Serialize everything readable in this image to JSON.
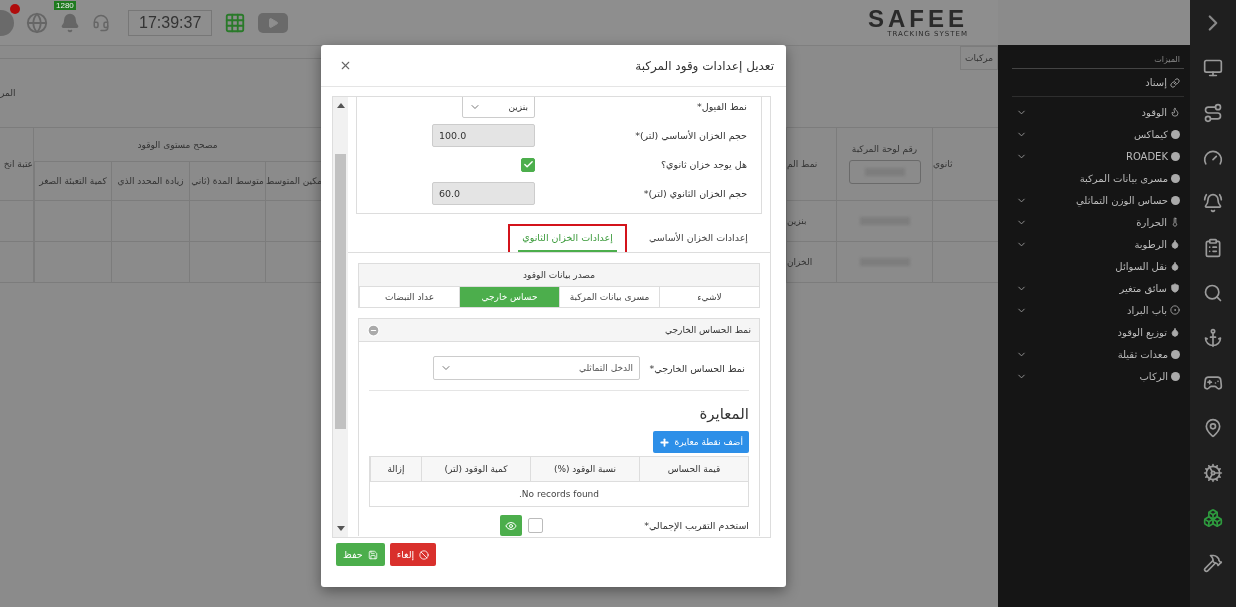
{
  "top_bar": {
    "notification_count": "1280",
    "clock": "17:39:37",
    "logo": {
      "name": "SAFEE",
      "tagline": "TRACKING SYSTEM"
    }
  },
  "background": {
    "tab_label": "مركبات",
    "section_label": "المر",
    "left_table": {
      "group": "مصحح مستوى الوقود",
      "columns": [
        "مكين المتوسط",
        "متوسط المدة (ثاني",
        "زيادة المحدد الذي",
        "كمية التعبئة الصغر"
      ],
      "end_column": "عتبة انخ"
    },
    "right_table": {
      "columns": [
        "ثانوي",
        "رقم لوحة المركبة",
        "نمط الم"
      ],
      "rows": [
        "بنزين",
        "الخزان"
      ]
    }
  },
  "sidebar": {
    "heading": "الميزات",
    "link": "إسناد",
    "items": [
      {
        "label": "الوقود",
        "kind": "flame",
        "expandable": true
      },
      {
        "label": "كيماكس",
        "kind": "dot",
        "expandable": true
      },
      {
        "label": "ROADEK",
        "kind": "dot",
        "expandable": true
      },
      {
        "label": "مسرى بيانات المركبة",
        "kind": "dot",
        "expandable": false
      },
      {
        "label": "حساس الوزن التماثلي",
        "kind": "dot",
        "expandable": true
      },
      {
        "label": "الحرارة",
        "kind": "thermometer",
        "expandable": true
      },
      {
        "label": "الرطوبة",
        "kind": "droplet",
        "expandable": true
      },
      {
        "label": "نقل السوائل",
        "kind": "droplet",
        "expandable": false
      },
      {
        "label": "سائق متغير",
        "kind": "shield",
        "expandable": true
      },
      {
        "label": "باب البراد",
        "kind": "target",
        "expandable": true
      },
      {
        "label": "توزيع الوقود",
        "kind": "droplet",
        "expandable": false
      },
      {
        "label": "معدات ثقيلة",
        "kind": "dot",
        "expandable": true
      },
      {
        "label": "الركاب",
        "kind": "dot",
        "expandable": true
      }
    ]
  },
  "rail": {
    "items": [
      {
        "kind": "monitor",
        "selected": false
      },
      {
        "kind": "route",
        "selected": false
      },
      {
        "kind": "gauge",
        "selected": false
      },
      {
        "kind": "bell",
        "selected": false
      },
      {
        "kind": "clipboard",
        "selected": false
      },
      {
        "kind": "search",
        "selected": false
      },
      {
        "kind": "anchor",
        "selected": false
      },
      {
        "kind": "gamepad",
        "selected": false
      },
      {
        "kind": "pin",
        "selected": false
      },
      {
        "kind": "gears",
        "selected": false
      },
      {
        "kind": "cubes",
        "selected": true
      },
      {
        "kind": "hammer",
        "selected": false
      }
    ]
  },
  "modal": {
    "title": "تعديل إعدادات وقود المركبة",
    "form": [
      {
        "kind": "select",
        "label": "نمط الفيول*",
        "value": "بنزين"
      },
      {
        "kind": "input",
        "label": "حجم الخزان الأساسي (لتر)*",
        "value": "100.0",
        "disabled": true
      },
      {
        "kind": "checkbox",
        "label": "هل يوجد خزان ثانوي؟",
        "checked": true
      },
      {
        "kind": "input",
        "label": "حجم الخزان الثانوي (لتر)*",
        "value": "60.0",
        "disabled": true
      }
    ],
    "tabs": [
      {
        "label": "إعدادات الخزان الأساسي",
        "selected": false,
        "highlighted": false
      },
      {
        "label": "إعدادات الخزان الثانوي",
        "selected": true,
        "highlighted": true
      }
    ],
    "source": {
      "title": "مصدر بيانات الوقود",
      "options": [
        {
          "label": "لاشيء",
          "selected": false
        },
        {
          "label": "مسرى بيانات المركبة",
          "selected": false
        },
        {
          "label": "حساس خارجي",
          "selected": true
        },
        {
          "label": "عداد النبضات",
          "selected": false
        }
      ]
    },
    "sensor": {
      "title": "نمط الحساس الخارجي",
      "field_label": "نمط الحساس الخارجي*",
      "field_value": "الدخل التماثلي",
      "calibration_title": "المعايرة",
      "add_button": "أضف نقطة معايرة",
      "columns": [
        "قيمة الحساس",
        "نسبة الوقود (%)",
        "كمية الوقود (لتر)",
        "إزالة"
      ],
      "empty_text": "No records found.",
      "approx_label": "استخدم التقريب الإجمالي*",
      "approx_checked": false
    },
    "buttons": [
      {
        "kind": "cancel",
        "label": "إلغاء"
      },
      {
        "kind": "save",
        "label": "حفظ"
      }
    ]
  }
}
